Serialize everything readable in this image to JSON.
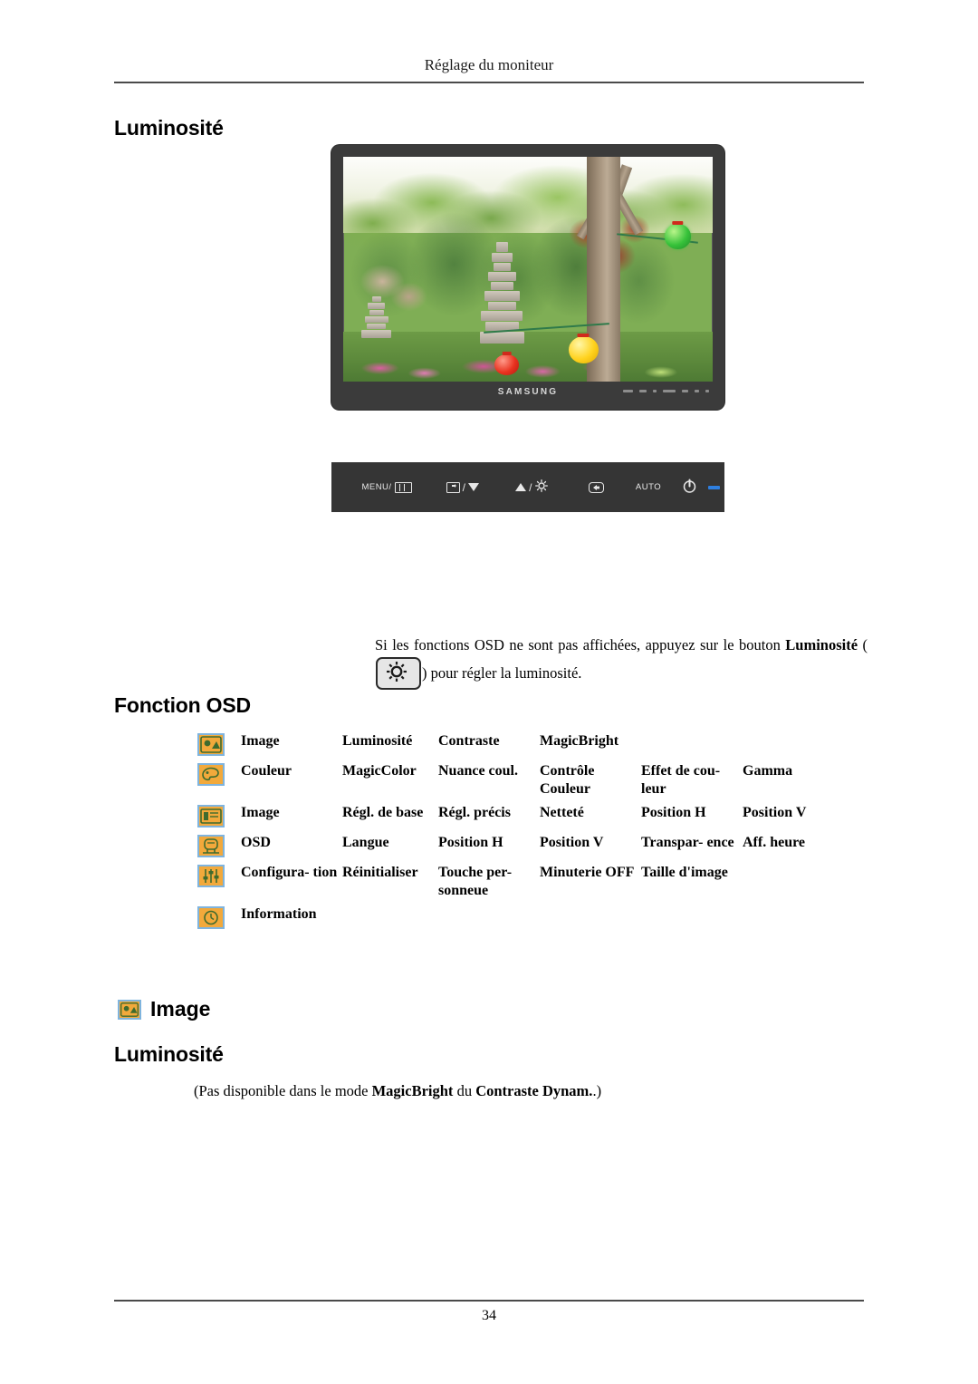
{
  "page": {
    "header_title": "Réglage du moniteur",
    "page_number": "34"
  },
  "sections": {
    "luminosite_heading_1": "Luminosité",
    "fonction_osd_heading": "Fonction OSD",
    "image_heading": "Image",
    "luminosite_heading_2": "Luminosité"
  },
  "monitor": {
    "brand": "SAMSUNG",
    "controls": {
      "menu_label": "MENU/",
      "menu_icon": "menu-grid-icon",
      "source_icon": "source-icon",
      "source_down_icon": "triangle-down-icon",
      "up_icon": "triangle-up-icon",
      "brightness_icon": "sun-icon",
      "enter_icon": "enter-icon",
      "auto_label": "AUTO",
      "power_icon": "power-icon",
      "led_indicator": "power-led-indicator",
      "separator": "/"
    }
  },
  "paragraphs": {
    "brightness_intro_part1": "Si les fonctions OSD ne sont pas affichées, appuyez sur le bouton ",
    "brightness_bold": "Luminosité",
    "brightness_paren_open": " (",
    "brightness_button_icon": "brightness-sun-button-icon",
    "brightness_paren_close": ") pour régler la luminosité.",
    "magicbright_part1": "(Pas disponible dans le mode ",
    "magicbright_bold1": "MagicBright",
    "magicbright_part2": " du ",
    "magicbright_bold2": "Contraste Dynam.",
    "magicbright_part3": ".)"
  },
  "osd_table": {
    "rows": [
      {
        "icon": "image-picture-icon",
        "name": "Image",
        "items": [
          "Luminosité",
          "Contraste",
          "MagicBright",
          "",
          ""
        ]
      },
      {
        "icon": "color-palette-icon",
        "name": "Couleur",
        "items": [
          "MagicColor",
          "Nuance coul.",
          "Contrôle Couleur",
          "Effet de cou- leur",
          "Gamma"
        ]
      },
      {
        "icon": "image-adjust-icon",
        "name": "Image",
        "items": [
          "Régl. de base",
          "Régl. précis",
          "Netteté",
          "Position H",
          "Position V"
        ]
      },
      {
        "icon": "osd-window-icon",
        "name": "OSD",
        "items": [
          "Langue",
          "Position H",
          "Position V",
          "Transpar- ence",
          "Aff. heure"
        ]
      },
      {
        "icon": "configuration-sliders-icon",
        "name": "Configura- tion",
        "items": [
          "Réinitialiser",
          "Touche per- sonneue",
          "Minuterie OFF",
          "Taille d'image",
          ""
        ]
      },
      {
        "icon": "information-clock-icon",
        "name": "Information",
        "items": [
          "",
          "",
          "",
          "",
          ""
        ]
      }
    ]
  },
  "colors": {
    "icon_fill": "#f2a93b",
    "icon_border": "#7fb4de",
    "icon_glyph": "#3e6b2e",
    "monitor_bezel": "#3b3b3b",
    "control_bar": "#353535",
    "led_blue": "#2e7fe0",
    "rule": "#4a4a4a"
  }
}
